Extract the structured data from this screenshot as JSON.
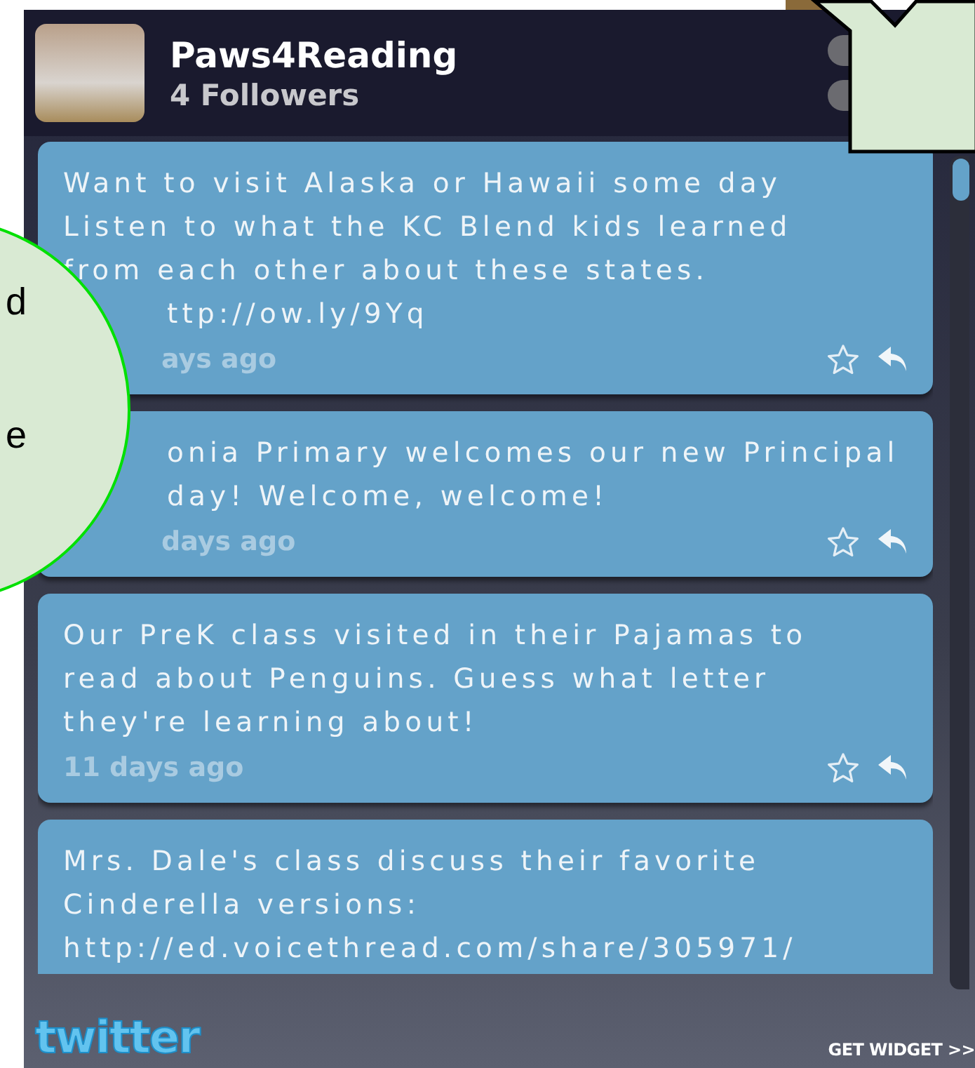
{
  "widget": {
    "title": "Paws4Reading",
    "followers": "4 Followers",
    "tweets": [
      {
        "lines": [
          {
            "text": "Want to visit Alaska or Hawaii some day",
            "cut": false
          },
          {
            "text": "Listen to what the KC Blend kids learned",
            "cut": false
          },
          {
            "text": "from each other about these states.",
            "cut": false
          },
          {
            "text": "ttp://ow.ly/9Yq",
            "cut": true
          }
        ],
        "time": "ays ago",
        "time_cut": true,
        "actions": true
      },
      {
        "lines": [
          {
            "text": "onia Primary welcomes our new Principal",
            "cut": true
          },
          {
            "text": "day!  Welcome, welcome!",
            "cut": true
          }
        ],
        "time": "days ago",
        "time_cut": true,
        "actions": true
      },
      {
        "lines": [
          {
            "text": "Our PreK class visited in their Pajamas to",
            "cut": false
          },
          {
            "text": "read about Penguins.  Guess what letter",
            "cut": false
          },
          {
            "text": "they're learning about!",
            "cut": false
          }
        ],
        "time": "11 days ago",
        "time_cut": false,
        "actions": true
      },
      {
        "lines": [
          {
            "text": "Mrs. Dale's class discuss their favorite",
            "cut": false
          },
          {
            "text": "Cinderella versions:",
            "cut": false
          },
          {
            "text": "http://ed.voicethread.com/share/305971/",
            "cut": false
          }
        ],
        "actions": false
      }
    ],
    "logo": "twitter",
    "get_widget": "GET WIDGET >>"
  },
  "callout": {
    "lines": [
      "d",
      "e"
    ]
  }
}
